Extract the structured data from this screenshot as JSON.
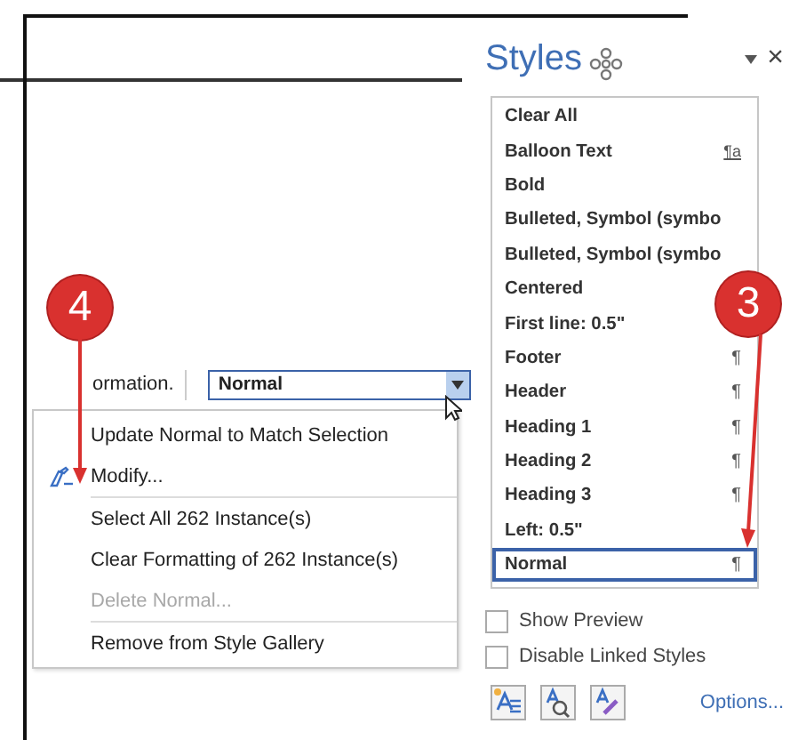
{
  "document": {
    "text_above": "ormation."
  },
  "style_box": {
    "value": "Normal"
  },
  "context_menu": [
    {
      "label": "Update Normal to Match Selection",
      "disabled": false,
      "kind": "plain",
      "separator_after": false
    },
    {
      "label": "Modify...",
      "disabled": false,
      "kind": "icon",
      "separator_after": true
    },
    {
      "label": "Select All 262 Instance(s)",
      "disabled": false,
      "kind": "plain",
      "separator_after": false
    },
    {
      "label": "Clear Formatting of 262 Instance(s)",
      "disabled": false,
      "kind": "plain",
      "separator_after": false
    },
    {
      "label": "Delete Normal...",
      "disabled": true,
      "kind": "plain",
      "separator_after": true
    },
    {
      "label": "Remove from Style Gallery",
      "disabled": false,
      "kind": "plain",
      "separator_after": false
    }
  ],
  "styles_pane": {
    "title": "Styles",
    "close": "×",
    "styles": [
      {
        "name": "Clear All",
        "selected": false
      },
      {
        "name": "Balloon Text",
        "marker": "¶a",
        "selected": false
      },
      {
        "name": "Bold",
        "selected": false
      },
      {
        "name": "Bulleted, Symbol (symbo",
        "selected": false
      },
      {
        "name": "Bulleted, Symbol (symbo",
        "selected": false
      },
      {
        "name": "Centered",
        "selected": false
      },
      {
        "name": "First line:  0.5\"",
        "selected": false
      },
      {
        "name": "Footer",
        "marker": "¶",
        "selected": false
      },
      {
        "name": "Header",
        "marker": "¶",
        "selected": false
      },
      {
        "name": "Heading 1",
        "marker": "¶",
        "selected": false
      },
      {
        "name": "Heading 2",
        "marker": "¶",
        "selected": false
      },
      {
        "name": "Heading 3",
        "marker": "¶",
        "selected": false
      },
      {
        "name": "Left:  0.5\"",
        "selected": false
      },
      {
        "name": "Normal",
        "marker": "¶",
        "selected": true
      }
    ],
    "checkboxes": [
      {
        "label": "Show Preview",
        "checked": false
      },
      {
        "label": "Disable Linked Styles",
        "checked": false
      }
    ],
    "options_link": "Options..."
  },
  "callouts": [
    {
      "number": "4"
    },
    {
      "number": "3"
    }
  ]
}
